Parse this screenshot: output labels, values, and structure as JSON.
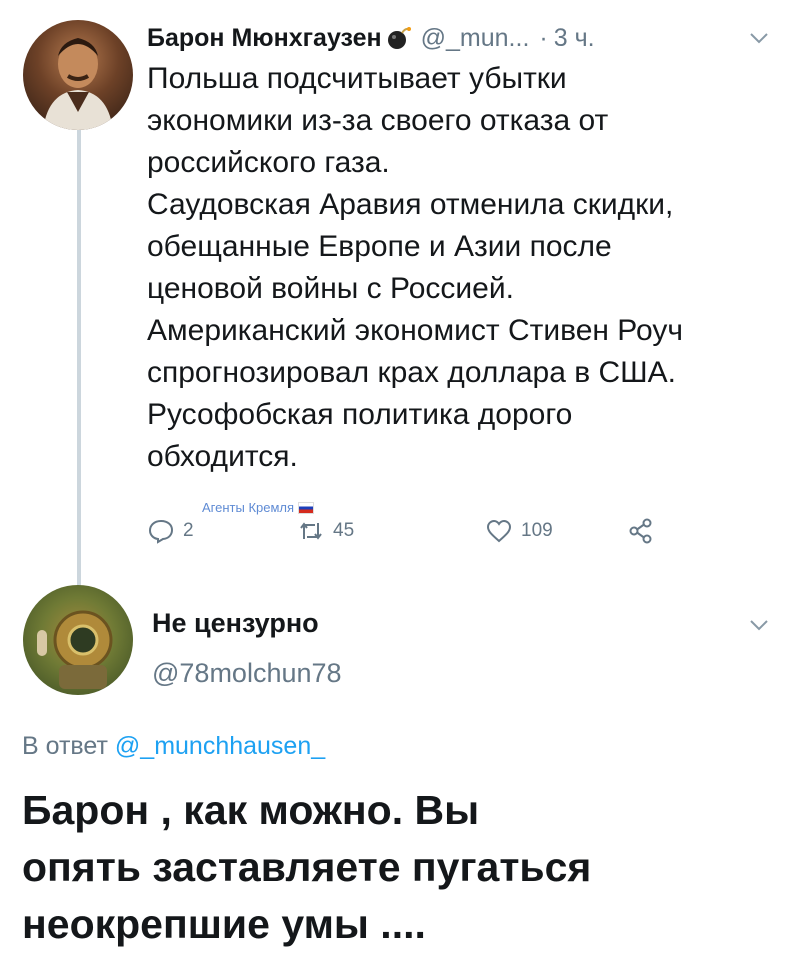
{
  "tweet": {
    "author_name": "Барон Мюнхгаузен",
    "handle": "@_mun...",
    "separator": "·",
    "time": "3 ч.",
    "body_lines": [
      "Польша подсчитывает убытки",
      "экономики из-за своего отказа от",
      "российского газа.",
      "Саудовская Аравия отменила скидки,",
      "обещанные Европе и Азии после",
      "ценовой войны с Россией.",
      "Американский экономист Стивен Роуч",
      "спрогнозировал крах  доллара в США.",
      "Русофобская политика дорого",
      "обходится."
    ],
    "watermark": "Агенты Кремля",
    "actions": {
      "reply_count": "2",
      "retweet_count": "45",
      "like_count": "109"
    }
  },
  "reply": {
    "author_name": "Не цензурно",
    "handle": "@78molchun78",
    "reply_to_label": "В ответ",
    "reply_to_handle": "@_munchhausen_",
    "body_lines": [
      "Барон , как можно. Вы",
      "опять заставляете пугаться",
      "неокрепшие умы ...."
    ]
  },
  "colors": {
    "text": "#14171a",
    "secondary": "#657786",
    "link": "#1da1f2",
    "thread_line": "#ccd6dd",
    "watermark": "#5f8bd4"
  },
  "icons": [
    "bomb-icon",
    "chevron-down-icon",
    "reply-icon",
    "retweet-icon",
    "heart-icon",
    "share-icon",
    "russia-flag-icon"
  ]
}
